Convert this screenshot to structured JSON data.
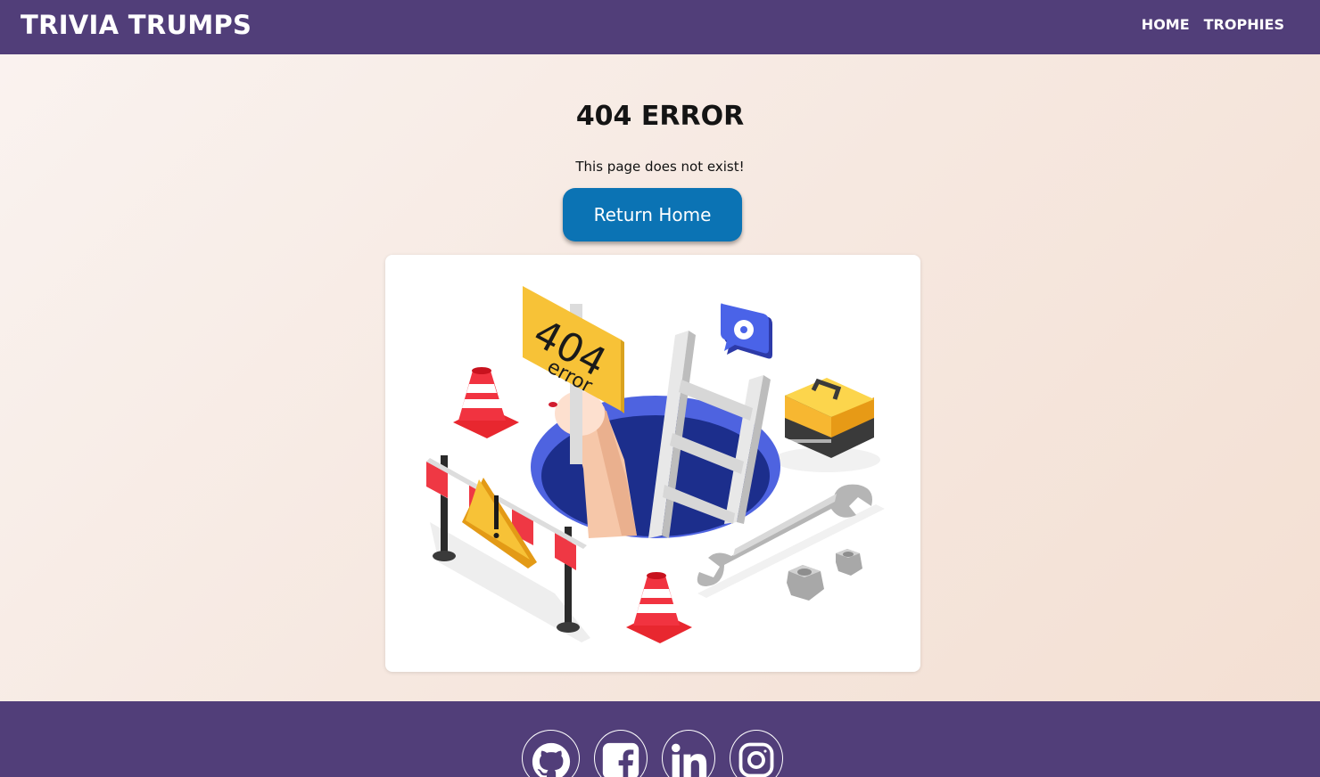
{
  "header": {
    "brand": "TRIVIA TRUMPS",
    "nav": [
      {
        "label": "HOME"
      },
      {
        "label": "TROPHIES"
      }
    ]
  },
  "main": {
    "title": "404 ERROR",
    "message": "This page does not exist!",
    "button_label": "Return Home",
    "illustration": {
      "sign_number": "404",
      "sign_word": "error"
    }
  },
  "footer": {
    "social": [
      {
        "icon": "github-icon"
      },
      {
        "icon": "facebook-icon"
      },
      {
        "icon": "linkedin-icon"
      },
      {
        "icon": "instagram-icon"
      }
    ]
  },
  "colors": {
    "header_bg": "#513e79",
    "button_bg": "#0b73b4",
    "page_bg": "#f6e8e0"
  }
}
